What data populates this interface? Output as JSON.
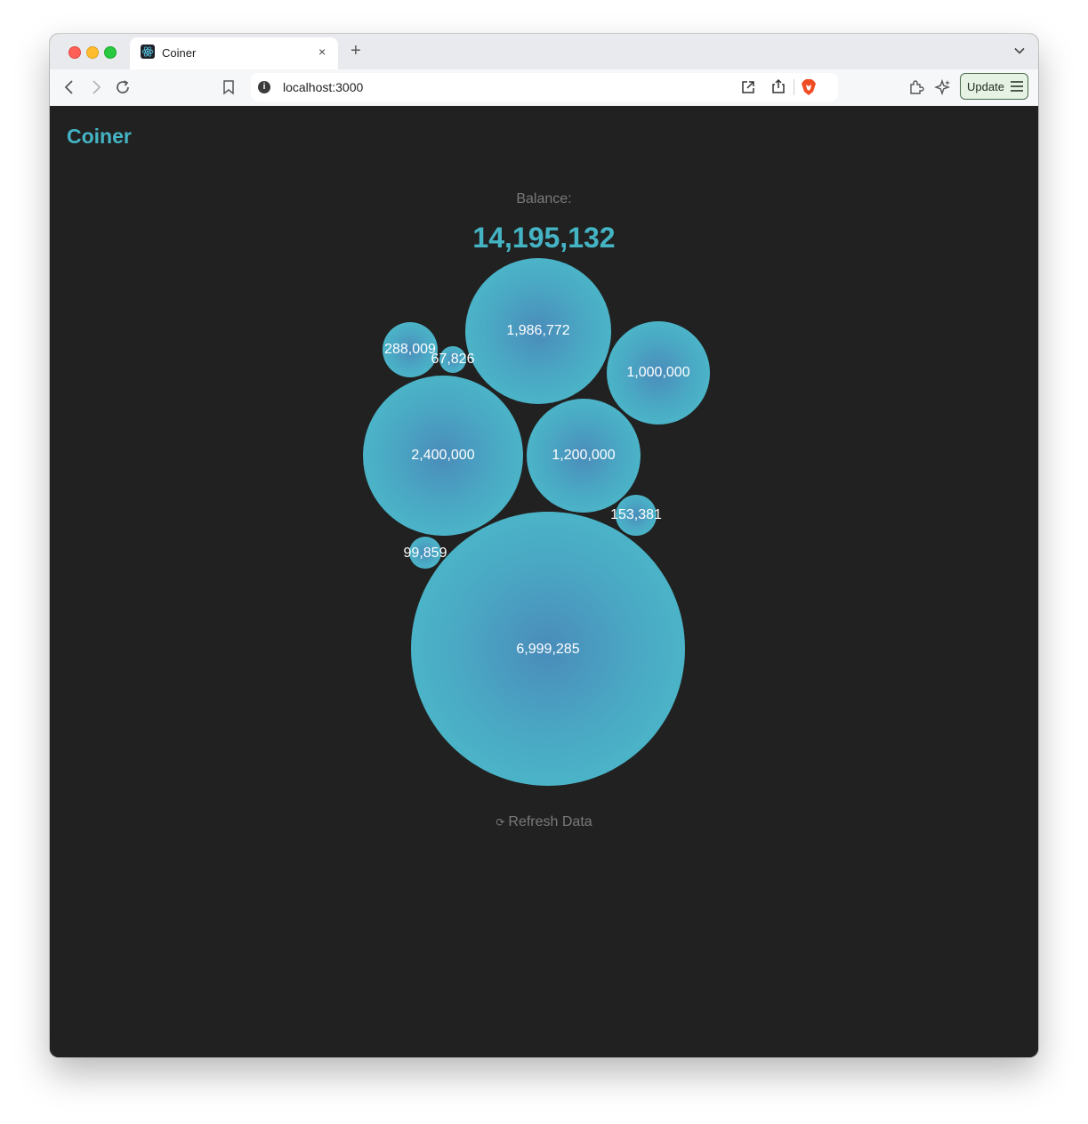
{
  "browser": {
    "tab_title": "Coiner",
    "tab_close_label": "×",
    "new_tab_label": "+",
    "url": "localhost:3000",
    "update_label": "Update",
    "accent_color": "#44b4c4"
  },
  "app": {
    "brand": "Coiner",
    "balance_label": "Balance:",
    "balance_value": "14,195,132",
    "refresh_icon": "⟳",
    "refresh_label": "Refresh Data"
  },
  "bubbles": [
    {
      "label": "1,986,772",
      "value": 1986772
    },
    {
      "label": "1,000,000",
      "value": 1000000
    },
    {
      "label": "288,009",
      "value": 288009
    },
    {
      "label": "67,826",
      "value": 67826
    },
    {
      "label": "2,400,000",
      "value": 2400000
    },
    {
      "label": "1,200,000",
      "value": 1200000
    },
    {
      "label": "153,381",
      "value": 153381
    },
    {
      "label": "99,859",
      "value": 99859
    },
    {
      "label": "6,999,285",
      "value": 6999285
    }
  ]
}
